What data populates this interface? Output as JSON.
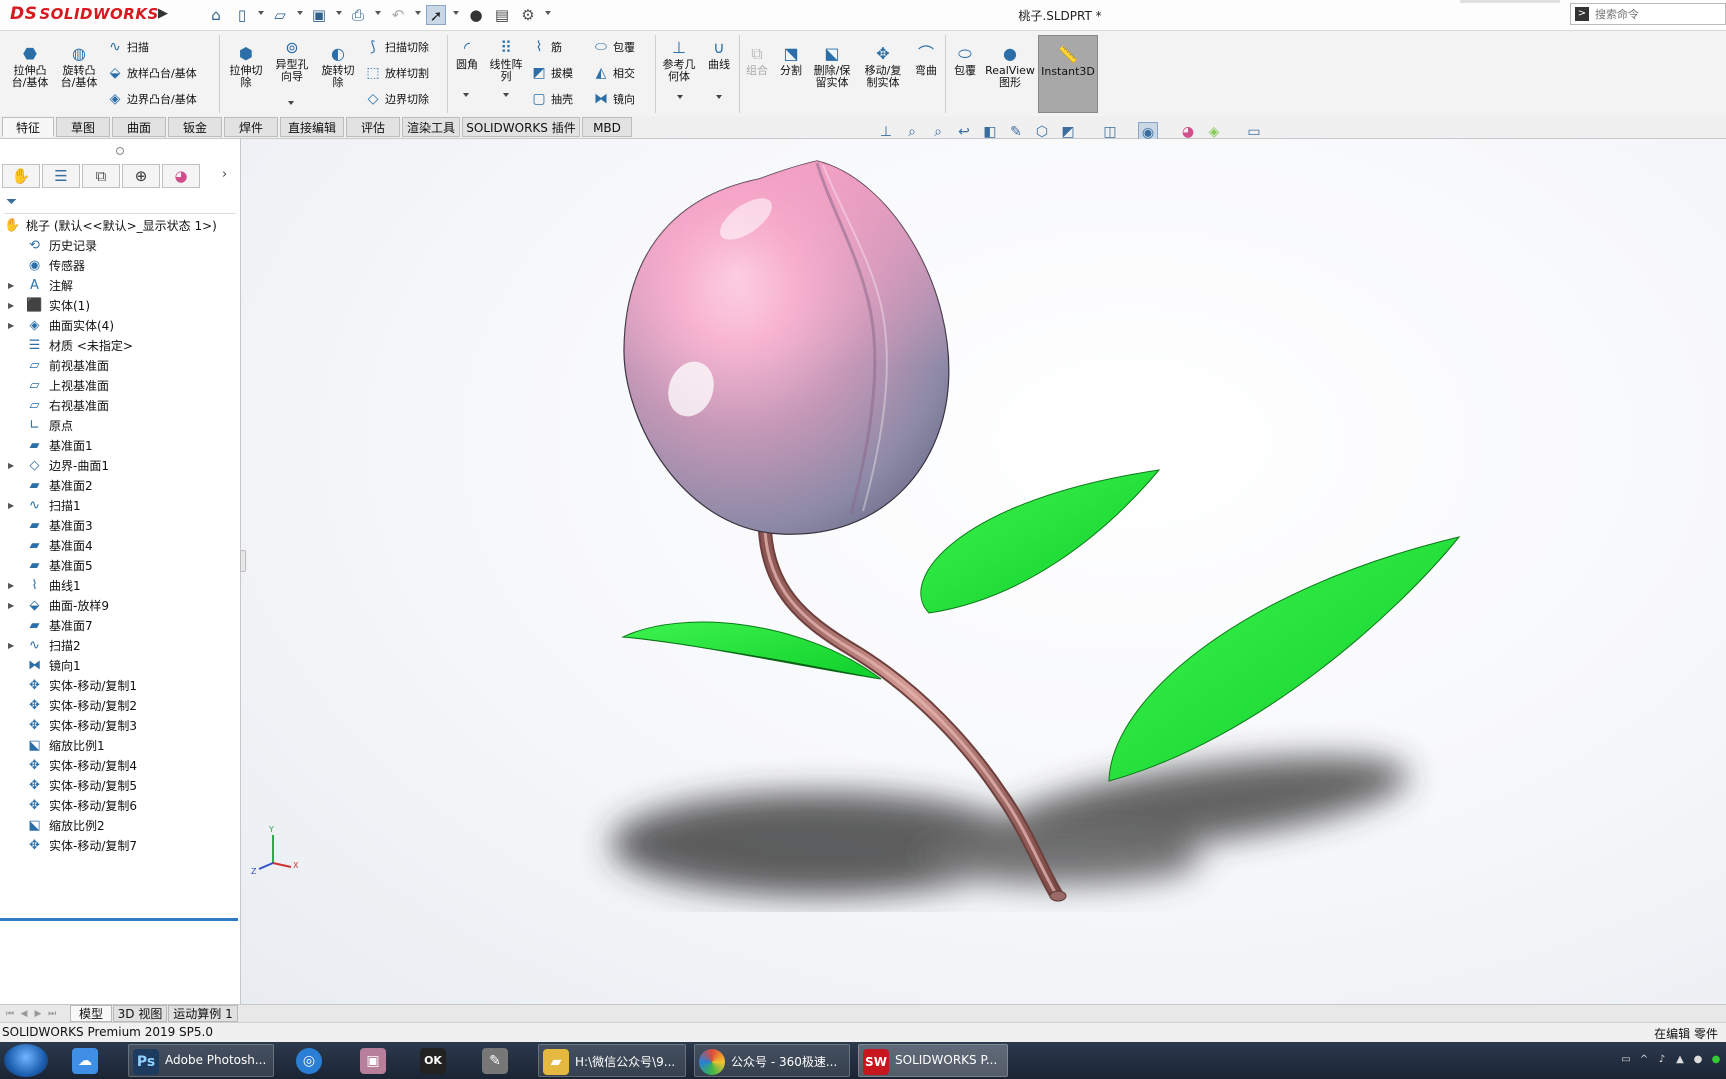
{
  "app": {
    "logo_text": "SOLIDWORKS",
    "logo_mark": "DS",
    "document_title": "桃子.SLDPRT *",
    "search_placeholder": "搜索命令"
  },
  "quick_access": [
    {
      "icon": "home-icon",
      "glyph": "⌂"
    },
    {
      "icon": "new-document-icon",
      "glyph": "🗋"
    },
    {
      "icon": "open-folder-icon",
      "glyph": "📂"
    },
    {
      "icon": "save-icon",
      "glyph": "💾"
    },
    {
      "icon": "print-icon",
      "glyph": "🖶"
    },
    {
      "icon": "undo-icon",
      "glyph": "↶"
    },
    {
      "icon": "select-arrow-icon",
      "glyph": "➚"
    },
    {
      "icon": "traffic-light-icon",
      "glyph": "⚫"
    },
    {
      "icon": "file-properties-icon",
      "glyph": "▤"
    },
    {
      "icon": "options-gear-icon",
      "glyph": "⚙"
    }
  ],
  "ribbon": {
    "extrude_boss": "拉伸凸\n台/基体",
    "revolve_boss": "旋转凸\n台/基体",
    "sweep": "扫描",
    "loft_boss": "放样凸台/基体",
    "boundary_boss": "边界凸台/基体",
    "extrude_cut": "拉伸切\n除",
    "hole_wizard": "异型孔\n向导",
    "revolve_cut": "旋转切\n除",
    "swept_cut": "扫描切除",
    "lofted_cut": "放样切割",
    "boundary_cut": "边界切除",
    "fillet": "圆角",
    "linear_pattern": "线性阵\n列",
    "rib": "筋",
    "draft": "拔模",
    "shell": "抽壳",
    "wrap": "包覆",
    "intersect": "相交",
    "mirror": "镜向",
    "reference_geometry": "参考几\n何体",
    "curves": "曲线",
    "combine": "组合",
    "split": "分割",
    "delete_keep_body": "删除/保\n留实体",
    "move_copy_body": "移动/复\n制实体",
    "flex": "弯曲",
    "wrap2": "包覆",
    "realview": "RealView\n图形",
    "instant3d": "Instant3D"
  },
  "command_tabs": [
    "特征",
    "草图",
    "曲面",
    "钣金",
    "焊件",
    "直接编辑",
    "评估",
    "渲染工具",
    "SOLIDWORKS 插件",
    "MBD"
  ],
  "heads_up_icons": [
    "view-orientation-icon",
    "zoom-to-fit-icon",
    "zoom-to-area-icon",
    "previous-view-icon",
    "section-view-icon",
    "dynamic-annotation-icon",
    "view-orientation-cube-icon",
    "display-style-icon",
    "hide-show-items-icon",
    "edit-appearance-icon",
    "apply-scene-icon",
    "view-settings-icon",
    "display-monitor-icon"
  ],
  "tree": {
    "root": "桃子 (默认<<默认>_显示状态 1>)",
    "items": [
      {
        "label": "历史记录",
        "icon": "history-icon",
        "expandable": false
      },
      {
        "label": "传感器",
        "icon": "sensor-icon",
        "expandable": false
      },
      {
        "label": "注解",
        "icon": "annotations-icon",
        "expandable": true
      },
      {
        "label": "实体(1)",
        "icon": "solid-bodies-icon",
        "expandable": true
      },
      {
        "label": "曲面实体(4)",
        "icon": "surface-bodies-icon",
        "expandable": true
      },
      {
        "label": "材质 <未指定>",
        "icon": "material-icon",
        "expandable": false
      },
      {
        "label": "前视基准面",
        "icon": "plane-icon",
        "expandable": false
      },
      {
        "label": "上视基准面",
        "icon": "plane-icon",
        "expandable": false
      },
      {
        "label": "右视基准面",
        "icon": "plane-icon",
        "expandable": false
      },
      {
        "label": "原点",
        "icon": "origin-icon",
        "expandable": false
      },
      {
        "label": "基准面1",
        "icon": "ref-plane-icon",
        "expandable": false
      },
      {
        "label": "边界-曲面1",
        "icon": "boundary-surface-icon",
        "expandable": true
      },
      {
        "label": "基准面2",
        "icon": "ref-plane-icon",
        "expandable": false
      },
      {
        "label": "扫描1",
        "icon": "sweep-icon",
        "expandable": true
      },
      {
        "label": "基准面3",
        "icon": "ref-plane-icon",
        "expandable": false
      },
      {
        "label": "基准面4",
        "icon": "ref-plane-icon",
        "expandable": false
      },
      {
        "label": "基准面5",
        "icon": "ref-plane-icon",
        "expandable": false
      },
      {
        "label": "曲线1",
        "icon": "curve-icon",
        "expandable": true
      },
      {
        "label": "曲面-放样9",
        "icon": "loft-surface-icon",
        "expandable": true
      },
      {
        "label": "基准面7",
        "icon": "ref-plane-icon",
        "expandable": false
      },
      {
        "label": "扫描2",
        "icon": "sweep-icon",
        "expandable": true
      },
      {
        "label": "镜向1",
        "icon": "mirror-icon",
        "expandable": false
      },
      {
        "label": "实体-移动/复制1",
        "icon": "move-copy-icon",
        "expandable": false
      },
      {
        "label": "实体-移动/复制2",
        "icon": "move-copy-icon",
        "expandable": false
      },
      {
        "label": "实体-移动/复制3",
        "icon": "move-copy-icon",
        "expandable": false
      },
      {
        "label": "缩放比例1",
        "icon": "scale-icon",
        "expandable": false
      },
      {
        "label": "实体-移动/复制4",
        "icon": "move-copy-icon",
        "expandable": false
      },
      {
        "label": "实体-移动/复制5",
        "icon": "move-copy-icon",
        "expandable": false
      },
      {
        "label": "实体-移动/复制6",
        "icon": "move-copy-icon",
        "expandable": false
      },
      {
        "label": "缩放比例2",
        "icon": "scale-icon",
        "expandable": false
      },
      {
        "label": "实体-移动/复制7",
        "icon": "move-copy-icon",
        "expandable": false
      }
    ]
  },
  "triad": {
    "x": "X",
    "y": "Y",
    "z": "Z"
  },
  "bottom_tabs": [
    "模型",
    "3D 视图",
    "运动算例 1"
  ],
  "status": {
    "left": "SOLIDWORKS Premium 2019 SP5.0",
    "right": "在编辑 零件"
  },
  "taskbar": {
    "items": [
      {
        "label": "",
        "icon": "baidu-netdisk-icon",
        "color": "#3f8fe6"
      },
      {
        "label": "Adobe Photosh...",
        "icon": "photoshop-icon",
        "glyph": "Ps",
        "color": "#1d3a5f"
      },
      {
        "label": "",
        "icon": "browser-icon",
        "color": "#2a7fd4"
      },
      {
        "label": "",
        "icon": "app-icon",
        "color": "#b77f9a"
      },
      {
        "label": "",
        "icon": "ok-recorder-icon",
        "glyph": "OK",
        "color": "#222"
      },
      {
        "label": "",
        "icon": "tool-icon",
        "color": "#777"
      },
      {
        "label": "H:\\微信公众号\\9...",
        "icon": "folder-icon",
        "color": "#e5b840"
      },
      {
        "label": "公众号 - 360极速...",
        "icon": "360-browser-icon",
        "color": "#e04b3b"
      },
      {
        "label": "SOLIDWORKS P...",
        "icon": "solidworks-icon",
        "glyph": "SW",
        "color": "#c7161d"
      }
    ]
  },
  "colors": {
    "accent_blue": "#2f7bc4",
    "peach_pink": "#f7a9c6",
    "leaf_green": "#1fe23a",
    "stem_brown": "#c98a86"
  }
}
